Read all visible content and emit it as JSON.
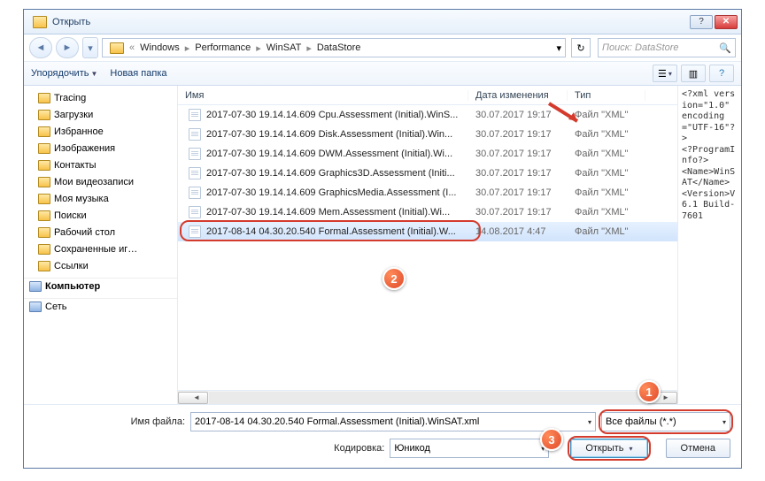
{
  "window": {
    "title": "Открыть"
  },
  "nav": {
    "crumbs": [
      "Windows",
      "Performance",
      "WinSAT",
      "DataStore"
    ],
    "search_placeholder": "Поиск: DataStore"
  },
  "toolbar": {
    "organize": "Упорядочить",
    "newfolder": "Новая папка"
  },
  "tree": {
    "items": [
      "Tracing",
      "Загрузки",
      "Избранное",
      "Изображения",
      "Контакты",
      "Мои видеозаписи",
      "Моя музыка",
      "Поиски",
      "Рабочий стол",
      "Сохраненные иг…",
      "Ссылки"
    ],
    "computer": "Компьютер",
    "network": "Сеть"
  },
  "columns": {
    "name": "Имя",
    "date": "Дата изменения",
    "type": "Тип"
  },
  "files": [
    {
      "name": "2017-07-30 19.14.14.609 Cpu.Assessment (Initial).WinS...",
      "date": "30.07.2017 19:17",
      "type": "Файл \"XML\""
    },
    {
      "name": "2017-07-30 19.14.14.609 Disk.Assessment (Initial).Win...",
      "date": "30.07.2017 19:17",
      "type": "Файл \"XML\""
    },
    {
      "name": "2017-07-30 19.14.14.609 DWM.Assessment (Initial).Wi...",
      "date": "30.07.2017 19:17",
      "type": "Файл \"XML\""
    },
    {
      "name": "2017-07-30 19.14.14.609 Graphics3D.Assessment (Initi...",
      "date": "30.07.2017 19:17",
      "type": "Файл \"XML\""
    },
    {
      "name": "2017-07-30 19.14.14.609 GraphicsMedia.Assessment (I...",
      "date": "30.07.2017 19:17",
      "type": "Файл \"XML\""
    },
    {
      "name": "2017-07-30 19.14.14.609 Mem.Assessment (Initial).Wi...",
      "date": "30.07.2017 19:17",
      "type": "Файл \"XML\""
    },
    {
      "name": "2017-08-14 04.30.20.540 Formal.Assessment (Initial).W...",
      "date": "14.08.2017 4:47",
      "type": "Файл \"XML\"",
      "selected": true
    }
  ],
  "preview": "<?xml version=\"1.0\" encoding=\"UTF-16\"?>\n<?ProgramInfo?>\n<Name>WinSAT</Name>\n<Version>V6.1 Build-7601",
  "bottom": {
    "filename_label": "Имя файла:",
    "filename_value": "2017-08-14 04.30.20.540 Formal.Assessment (Initial).WinSAT.xml",
    "filter": "Все файлы (*.*)",
    "encoding_label": "Кодировка:",
    "encoding_value": "Юникод",
    "open": "Открыть",
    "cancel": "Отмена"
  },
  "badges": {
    "b1": "1",
    "b2": "2",
    "b3": "3"
  }
}
